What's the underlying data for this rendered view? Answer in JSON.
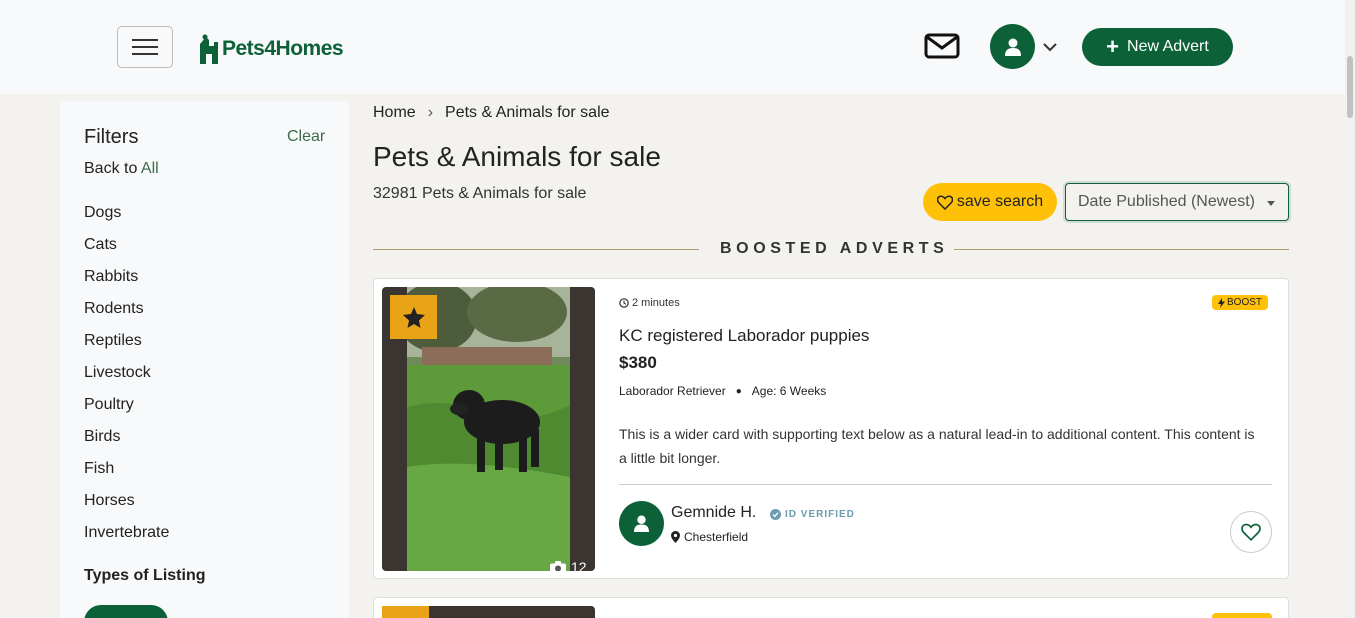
{
  "header": {
    "logo_text": "Pets4Homes",
    "new_advert_label": "New Advert",
    "brand_color": "#0c6138"
  },
  "sidebar": {
    "title": "Filters",
    "clear_label": "Clear",
    "back_to_prefix": "Back to",
    "back_to_link": "All",
    "categories": [
      "Dogs",
      "Cats",
      "Rabbits",
      "Rodents",
      "Reptiles",
      "Livestock",
      "Poultry",
      "Birds",
      "Fish",
      "Horses",
      "Invertebrate"
    ],
    "types_title": "Types of Listing"
  },
  "breadcrumb": {
    "home": "Home",
    "separator": "›",
    "current": "Pets & Animals for sale"
  },
  "main": {
    "title": "Pets & Animals for sale",
    "result_count": "32981 Pets & Animals for sale",
    "save_search_label": "save search",
    "sort_value": "Date Published (Newest)",
    "boosted_heading": "BOOSTED ADVERTS"
  },
  "listing": {
    "time": "2 minutes",
    "boost_label": "BOOST",
    "title": "KC registered Laborador puppies",
    "price": "$380",
    "breed": "Laborador Retriever",
    "age": "Age: 6 Weeks",
    "description": "This is a wider card with supporting text below as a natural lead-in to additional content. This content is a little bit longer.",
    "photo_count": "12",
    "seller_name": "Gemnide H.",
    "verified_label": "ID VERIFIED",
    "location": "Chesterfield"
  }
}
